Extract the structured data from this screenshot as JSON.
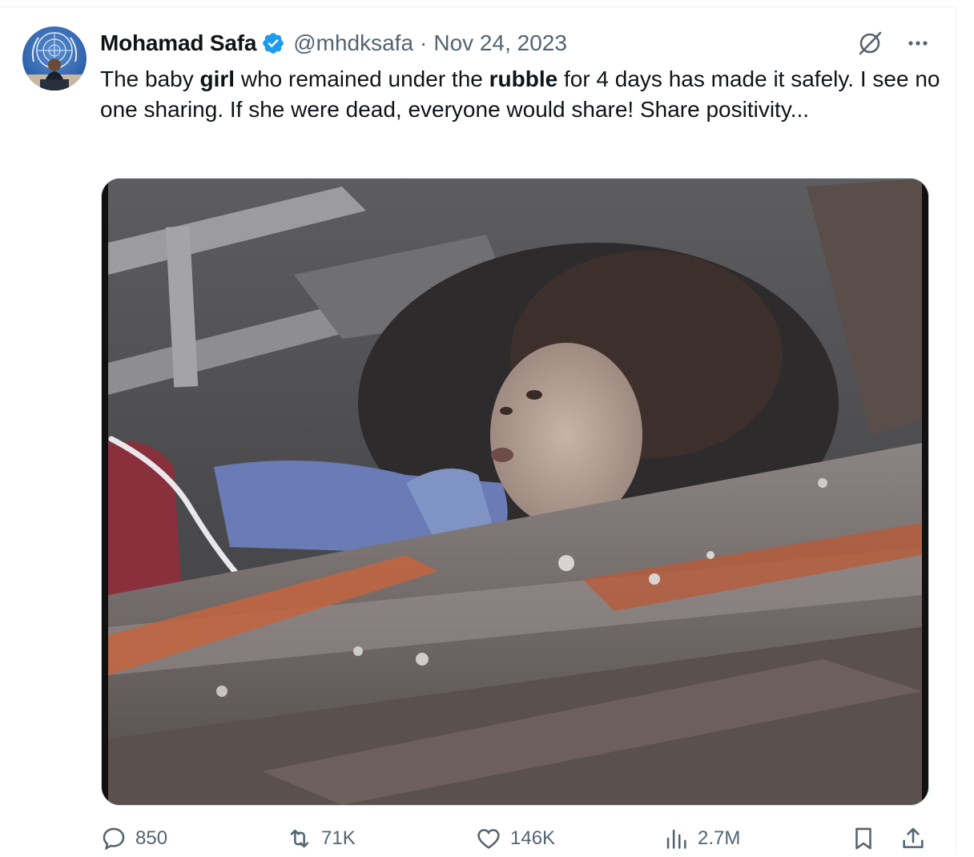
{
  "tweet": {
    "author_name": "Mohamad Safa",
    "handle": "@mhdksafa",
    "separator": "·",
    "date": "Nov 24, 2023",
    "text_segments": [
      {
        "text": "The baby ",
        "bold": false
      },
      {
        "text": "girl",
        "bold": true
      },
      {
        "text": " who remained under the ",
        "bold": false
      },
      {
        "text": "rubble",
        "bold": true
      },
      {
        "text": " for 4 days has made it safely. I see no one sharing. If she were dead, everyone would share! Share positivity...",
        "bold": false
      }
    ]
  },
  "icons": {
    "verified": "verified-badge-icon",
    "grok": "grok-icon",
    "more": "more-icon",
    "reply": "reply-icon",
    "retweet": "retweet-icon",
    "like": "like-icon",
    "views": "views-icon",
    "bookmark": "bookmark-icon",
    "share": "share-icon"
  },
  "stats": {
    "replies": "850",
    "retweets": "71K",
    "likes": "146K",
    "views": "2.7M"
  },
  "colors": {
    "verified_blue": "#1d9bf0",
    "text_primary": "#0f1419",
    "text_secondary": "#536471",
    "border": "#cfd9de"
  }
}
